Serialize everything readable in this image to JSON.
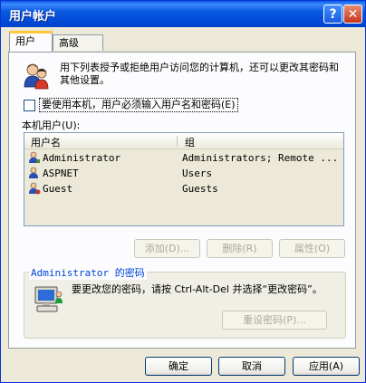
{
  "window": {
    "title": "用户帐户"
  },
  "titlebar": {
    "help_glyph": "?",
    "close_glyph": "✕"
  },
  "tabs": [
    {
      "label": "用户"
    },
    {
      "label": "高级"
    }
  ],
  "intro": {
    "text": "用下列表授予或拒绝用户访问您的计算机，还可以更改其密码和其他设置。"
  },
  "require_login": {
    "label": "要使用本机，用户必须输入用户名和密码(E)",
    "checked": false
  },
  "users_list": {
    "label": "本机用户(U):",
    "columns": [
      "用户名",
      "组"
    ],
    "rows": [
      {
        "name": "Administrator",
        "group": "Administrators; Remote ..."
      },
      {
        "name": "ASPNET",
        "group": "Users"
      },
      {
        "name": "Guest",
        "group": "Guests"
      }
    ]
  },
  "list_buttons": {
    "add": "添加(D)...",
    "remove": "删除(R)",
    "properties": "属性(O)"
  },
  "password_group": {
    "title": "Administrator 的密码",
    "text": "要更改您的密码，请按 Ctrl-Alt-Del 并选择“更改密码”。",
    "reset_button": "重设密码(P)..."
  },
  "dialog_buttons": {
    "ok": "确定",
    "cancel": "取消",
    "apply": "应用(A)"
  },
  "colors": {
    "titlebar": "#0a5ae0",
    "accent": "#ffc83c",
    "disabled_text": "#aca899"
  }
}
